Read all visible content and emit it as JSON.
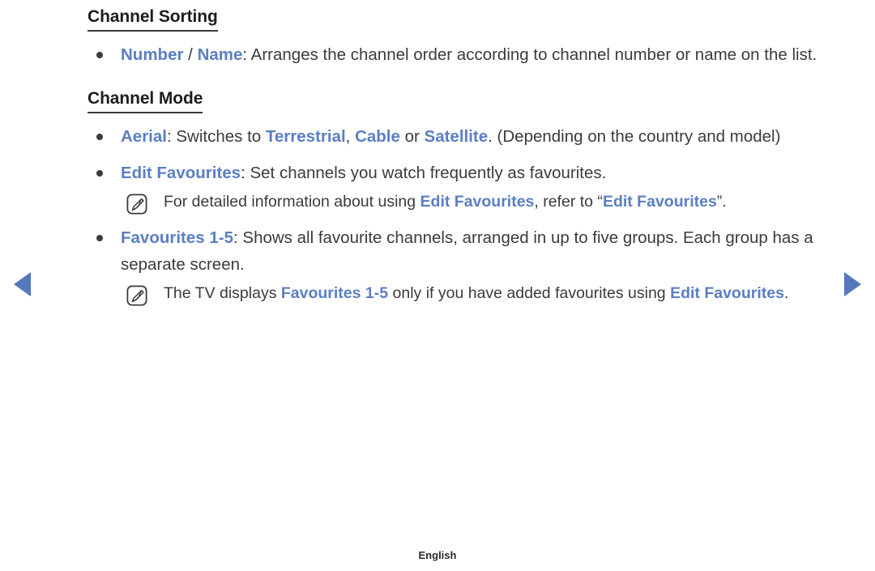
{
  "nav": {
    "prev_label": "◀",
    "next_label": "▶",
    "arrow_color": "#5577bb"
  },
  "theme": {
    "keyword_blue": "#5b7ec4",
    "body_text": "#3b3b3b",
    "heading_text": "#1d1d1d",
    "background": "#ffffff"
  },
  "sections": [
    {
      "title": "Channel Sorting",
      "bullets": [
        {
          "parts": [
            {
              "text": "Number",
              "style": "keyword"
            },
            {
              "text": " / ",
              "style": "plain"
            },
            {
              "text": "Name",
              "style": "keyword"
            },
            {
              "text": ": Arranges the channel order according to channel number or name on the list.",
              "style": "plain"
            }
          ],
          "notes": []
        }
      ]
    },
    {
      "title": "Channel Mode",
      "bullets": [
        {
          "parts": [
            {
              "text": "Aerial",
              "style": "keyword"
            },
            {
              "text": ": Switches to ",
              "style": "plain"
            },
            {
              "text": "Terrestrial",
              "style": "keyword"
            },
            {
              "text": ", ",
              "style": "plain"
            },
            {
              "text": "Cable",
              "style": "keyword"
            },
            {
              "text": " or ",
              "style": "plain"
            },
            {
              "text": "Satellite",
              "style": "keyword"
            },
            {
              "text": ". (Depending on the country and model)",
              "style": "plain"
            }
          ],
          "notes": []
        },
        {
          "parts": [
            {
              "text": "Edit Favourites",
              "style": "keyword"
            },
            {
              "text": ": Set channels you watch frequently as favourites.",
              "style": "plain"
            }
          ],
          "notes": [
            {
              "icon": "note-pencil-icon",
              "parts": [
                {
                  "text": "For detailed information about using ",
                  "style": "plain"
                },
                {
                  "text": "Edit Favourites",
                  "style": "keyword"
                },
                {
                  "text": ", refer to “",
                  "style": "plain"
                },
                {
                  "text": "Edit Favourites",
                  "style": "keyword"
                },
                {
                  "text": "”.",
                  "style": "plain"
                }
              ]
            }
          ]
        },
        {
          "parts": [
            {
              "text": "Favourites 1-5",
              "style": "keyword"
            },
            {
              "text": ": Shows all favourite channels, arranged in up to five groups. Each group has a separate screen.",
              "style": "plain"
            }
          ],
          "notes": [
            {
              "icon": "note-pencil-icon",
              "parts": [
                {
                  "text": "The TV displays ",
                  "style": "plain"
                },
                {
                  "text": "Favourites 1-5",
                  "style": "keyword"
                },
                {
                  "text": " only if you have added favourites using ",
                  "style": "plain"
                },
                {
                  "text": "Edit Favourites",
                  "style": "keyword"
                },
                {
                  "text": ".",
                  "style": "plain"
                }
              ]
            }
          ]
        }
      ]
    }
  ],
  "footer": {
    "language": "English"
  }
}
